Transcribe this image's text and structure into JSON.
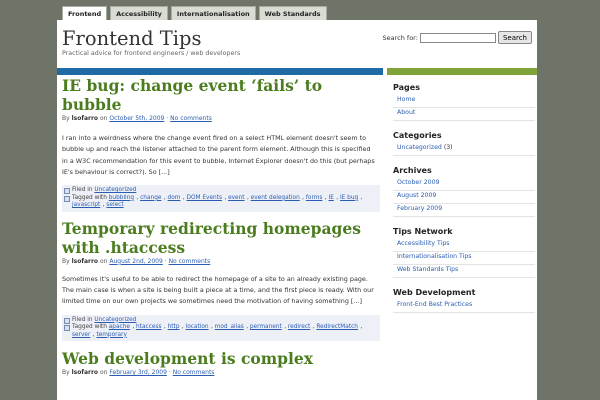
{
  "nav": {
    "tabs": [
      {
        "label": "Frontend",
        "active": true
      },
      {
        "label": "Accessibility"
      },
      {
        "label": "Internationalisation"
      },
      {
        "label": "Web Standards"
      }
    ]
  },
  "site": {
    "title": "Frontend Tips",
    "tagline": "Practical advice for frontend engineers / web developers"
  },
  "search": {
    "label": "Search for:",
    "value": "",
    "button": "Search"
  },
  "posts": [
    {
      "title": "IE bug: change event ‘fails’ to bubble",
      "meta": {
        "by": "By",
        "author": "lsofarro",
        "on": "on",
        "date": "October 5th, 2009",
        "sep": "·",
        "comments": "No comments"
      },
      "excerpt": "I ran into a weirdness where the change event fired on a select HTML element doesn't seem to bubble up and reach the listener attached to the parent form element. Although this is specified in a W3C recommendation for this event to bubble, Internet Explorer doesn't do this (but perhaps IE's behaviour is correct?). So [...]",
      "filed_in": "Filed in",
      "category": "Uncategorized",
      "tagged_with": "Tagged with",
      "tags": [
        "bubbling",
        "change",
        "dom",
        "DOM Events",
        "event",
        "event delegation",
        "forms",
        "IE",
        "IE bug",
        "javascript",
        "select"
      ]
    },
    {
      "title": "Temporary redirecting homepages with .htaccess",
      "meta": {
        "by": "By",
        "author": "lsofarro",
        "on": "on",
        "date": "August 2nd, 2009",
        "sep": "·",
        "comments": "No comments"
      },
      "excerpt": "Sometimes it's useful to be able to redirect the homepage of a site to an already existing page. The main case is when a site is being built a piece at a time, and the first piece is ready. With our limited time on our own projects we sometimes need the motivation of having something [...]",
      "filed_in": "Filed in",
      "category": "Uncategorized",
      "tagged_with": "Tagged with",
      "tags": [
        "apache",
        "htaccess",
        "http",
        "location",
        "mod_alias",
        "permanent",
        "redirect",
        "RedirectMatch",
        "server",
        "temporary"
      ]
    },
    {
      "title": "Web development is complex",
      "meta": {
        "by": "By",
        "author": "lsofarro",
        "on": "on",
        "date": "February 3rd, 2009",
        "sep": "·",
        "comments": "No comments"
      }
    }
  ],
  "sidebar": {
    "pages": {
      "title": "Pages",
      "items": [
        "Home",
        "About"
      ]
    },
    "categories": {
      "title": "Categories",
      "items": [
        {
          "label": "Uncategorized",
          "count": "(3)"
        }
      ]
    },
    "archives": {
      "title": "Archives",
      "items": [
        "October 2009",
        "August 2009",
        "February 2009"
      ]
    },
    "network": {
      "title": "Tips Network",
      "items": [
        "Accessibility Tips",
        "Internationalisation Tips",
        "Web Standards Tips"
      ]
    },
    "webdev": {
      "title": "Web Development",
      "items": [
        "Front-End Best Practices"
      ]
    }
  }
}
